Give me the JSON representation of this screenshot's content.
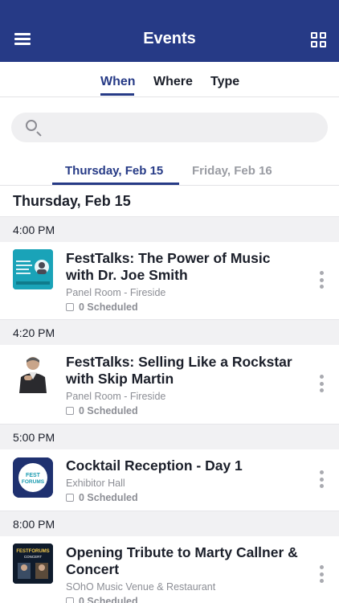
{
  "header": {
    "title": "Events"
  },
  "filter_tabs": [
    {
      "label": "When",
      "active": true
    },
    {
      "label": "Where",
      "active": false
    },
    {
      "label": "Type",
      "active": false
    }
  ],
  "search": {
    "value": "",
    "placeholder": ""
  },
  "day_tabs": [
    {
      "label": "Thursday, Feb 15",
      "active": true
    },
    {
      "label": "Friday, Feb 16",
      "active": false
    }
  ],
  "day_header": "Thursday, Feb 15",
  "groups": [
    {
      "time": "4:00 PM",
      "event": {
        "title": "FestTalks: The Power of Music with Dr. Joe Smith",
        "location": "Panel Room - Fireside",
        "scheduled": "0 Scheduled"
      }
    },
    {
      "time": "4:20 PM",
      "event": {
        "title": "FestTalks: Selling Like a Rockstar with Skip Martin",
        "location": "Panel Room - Fireside",
        "scheduled": "0 Scheduled"
      }
    },
    {
      "time": "5:00 PM",
      "event": {
        "title": "Cocktail Reception - Day 1",
        "location": "Exhibitor Hall",
        "scheduled": "0 Scheduled"
      }
    },
    {
      "time": "8:00 PM",
      "event": {
        "title": "Opening Tribute to Marty Callner & Concert",
        "location": "SOhO Music Venue & Restaurant",
        "scheduled": "0 Scheduled"
      }
    }
  ],
  "thumb_text": {
    "fest_forums_1": "FEST",
    "fest_forums_2": "FORUMS",
    "festforums_banner": "FESTFORUMS",
    "concert": "CONCERT"
  },
  "colors": {
    "brand": "#263a86",
    "teal": "#1a9bb0"
  }
}
